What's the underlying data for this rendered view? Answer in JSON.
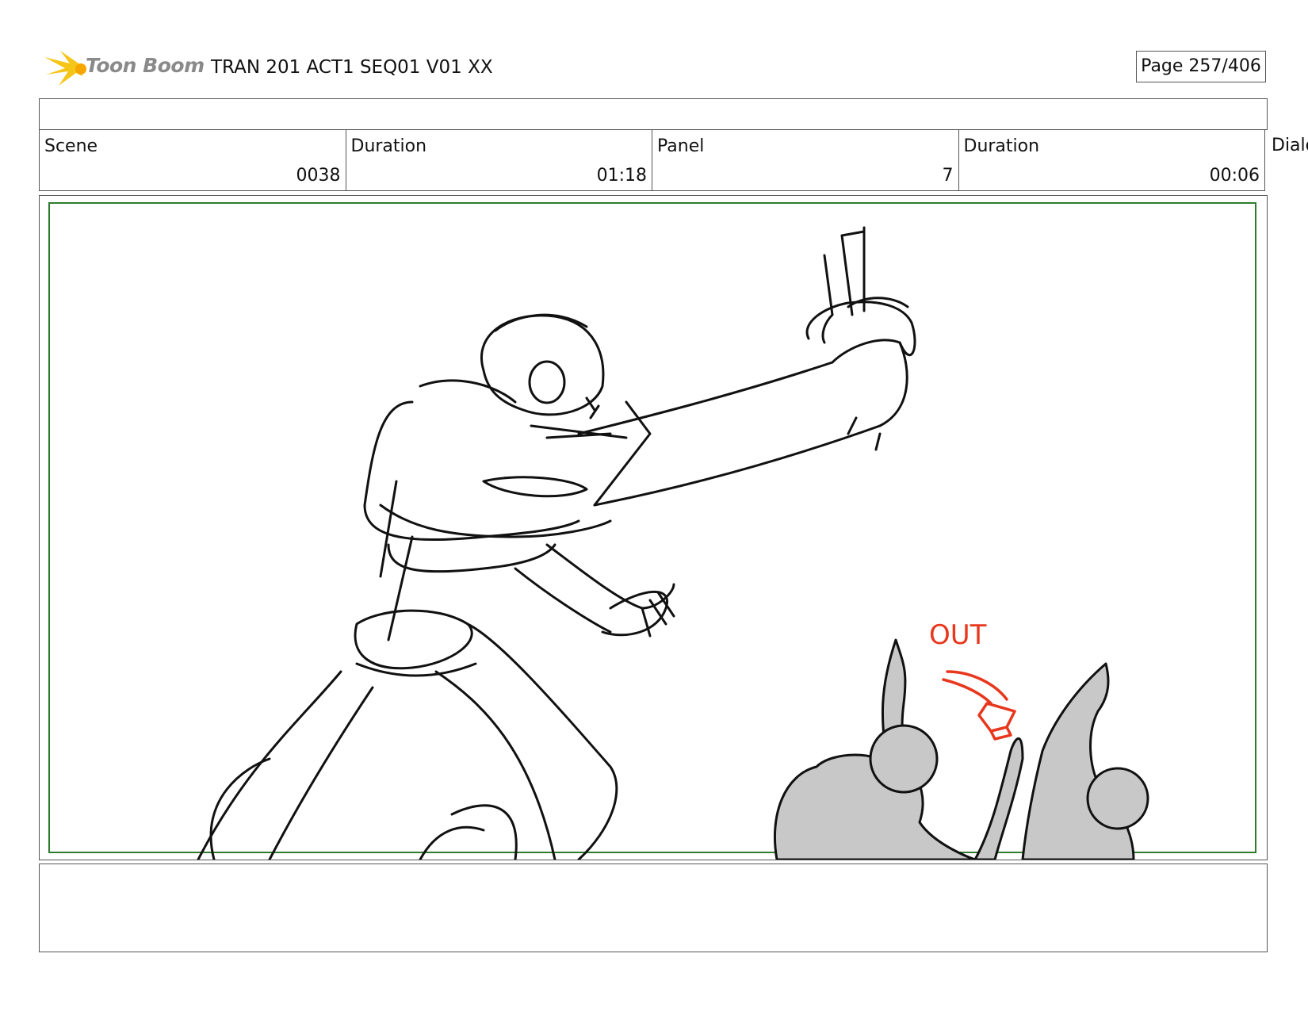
{
  "header": {
    "logo_name": "Toon Boom",
    "doc_title": "TRAN 201 ACT1 SEQ01 V01 XX",
    "page": "Page 257/406"
  },
  "info": {
    "scene_label": "Scene",
    "scene_value": "0038",
    "scene_duration_label": "Duration",
    "scene_duration_value": "01:18",
    "panel_label": "Panel",
    "panel_value": "7",
    "panel_duration_label": "Duration",
    "panel_duration_value": "00:06",
    "dialog_label": "Dialog"
  },
  "panel": {
    "annotation": "OUT",
    "annotation_color": "#e8371d",
    "safe_area_color": "#2e7d2e",
    "crowd_fill": "#c8c8c8"
  },
  "colors": {
    "logo_star": "#f5c518",
    "logo_text": "#8a8a8a",
    "frame_border": "#555555"
  }
}
